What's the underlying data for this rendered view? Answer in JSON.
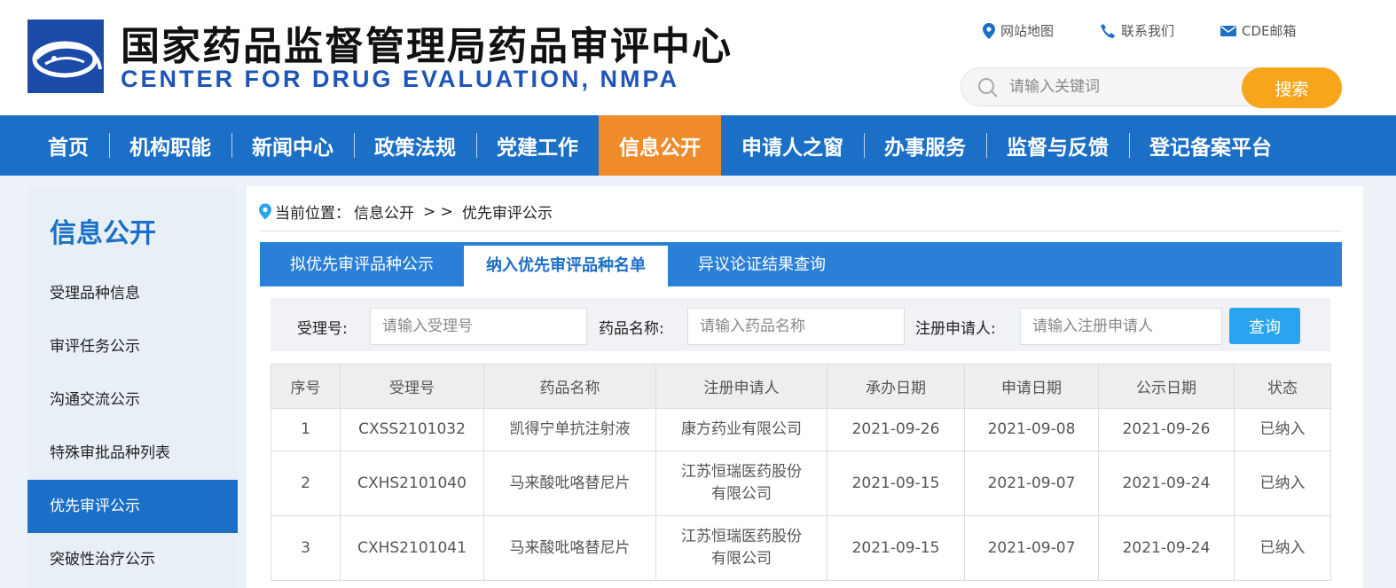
{
  "header": {
    "title_cn": "国家药品监督管理局药品审评中心",
    "title_en": "CENTER FOR DRUG EVALUATION, NMPA",
    "links": [
      {
        "label": "网站地图",
        "icon": "location-pin-icon"
      },
      {
        "label": "联系我们",
        "icon": "phone-icon"
      },
      {
        "label": "CDE邮箱",
        "icon": "mail-icon"
      }
    ],
    "search": {
      "placeholder": "请输入关键词",
      "button": "搜索"
    }
  },
  "nav": {
    "items": [
      "首页",
      "机构职能",
      "新闻中心",
      "政策法规",
      "党建工作",
      "信息公开",
      "申请人之窗",
      "办事服务",
      "监督与反馈",
      "登记备案平台"
    ],
    "active": "信息公开"
  },
  "sidebar": {
    "title": "信息公开",
    "items": [
      "受理品种信息",
      "审评任务公示",
      "沟通交流公示",
      "特殊审批品种列表",
      "优先审评公示",
      "突破性治疗公示"
    ],
    "active": "优先审评公示"
  },
  "breadcrumb": {
    "prefix": "当前位置：",
    "section": "信息公开",
    "separator": "> >",
    "current": "优先审评公示"
  },
  "tabs": {
    "items": [
      "拟优先审评品种公示",
      "纳入优先审评品种名单",
      "异议论证结果查询"
    ],
    "active": "纳入优先审评品种名单"
  },
  "filter": {
    "accept_no": {
      "label": "受理号:",
      "placeholder": "请输入受理号"
    },
    "drug_name": {
      "label": "药品名称:",
      "placeholder": "请输入药品名称"
    },
    "applicant": {
      "label": "注册申请人:",
      "placeholder": "请输入注册申请人"
    },
    "button": "查询"
  },
  "table": {
    "headers": [
      "序号",
      "受理号",
      "药品名称",
      "注册申请人",
      "承办日期",
      "申请日期",
      "公示日期",
      "状态"
    ],
    "rows": [
      {
        "no": "1",
        "accept_no": "CXSS2101032",
        "drug": "凯得宁单抗注射液",
        "applicant": "康方药业有限公司",
        "handled": "2021-09-26",
        "applied": "2021-09-08",
        "published": "2021-09-26",
        "status": "已纳入"
      },
      {
        "no": "2",
        "accept_no": "CXHS2101040",
        "drug": "马来酸吡咯替尼片",
        "applicant": "江苏恒瑞医药股份有限公司",
        "handled": "2021-09-15",
        "applied": "2021-09-07",
        "published": "2021-09-24",
        "status": "已纳入"
      },
      {
        "no": "3",
        "accept_no": "CXHS2101041",
        "drug": "马来酸吡咯替尼片",
        "applicant": "江苏恒瑞医药股份有限公司",
        "handled": "2021-09-15",
        "applied": "2021-09-07",
        "published": "2021-09-24",
        "status": "已纳入"
      }
    ]
  },
  "colors": {
    "nav_blue": "#1c6fc7",
    "active_orange": "#f08b2b",
    "search_orange": "#f7a61c",
    "query_blue": "#2aa4ee"
  }
}
